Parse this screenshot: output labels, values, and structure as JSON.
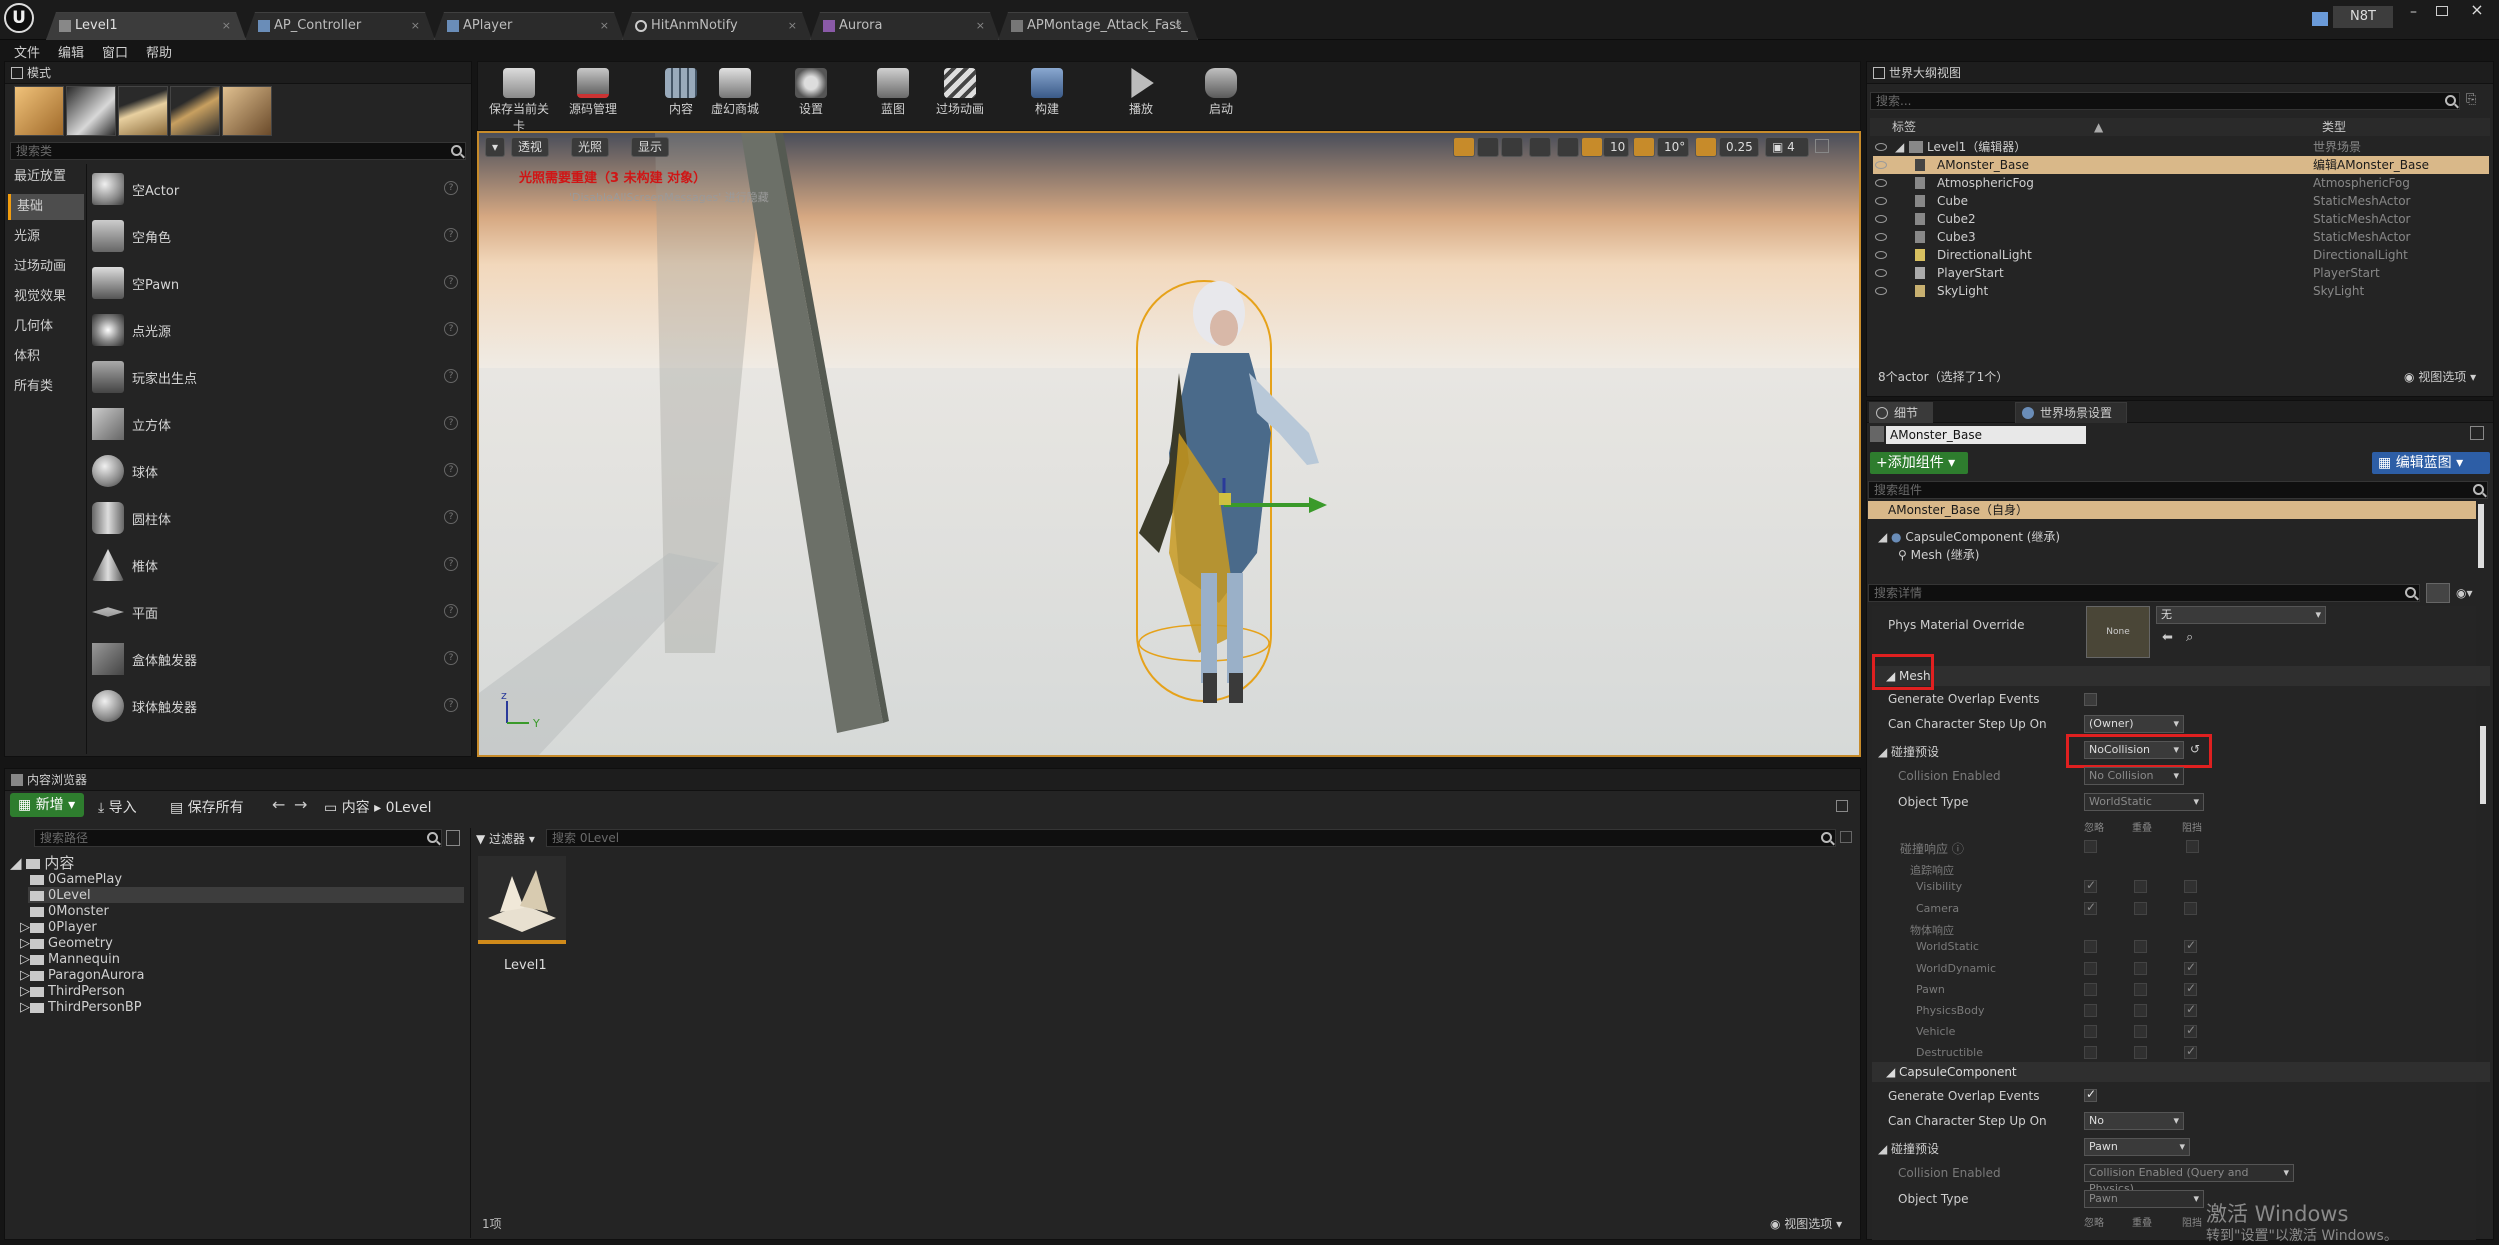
{
  "window": {
    "tabs": [
      {
        "label": "Level1"
      },
      {
        "label": "AP_Controller"
      },
      {
        "label": "APlayer"
      },
      {
        "label": "HitAnmNotify"
      },
      {
        "label": "Aurora"
      },
      {
        "label": "APMontage_Attack_Fast_"
      }
    ],
    "user": "N8T",
    "close": "×"
  },
  "menu": [
    "文件",
    "编辑",
    "窗口",
    "帮助"
  ],
  "modes": {
    "title": "模式",
    "search_placeholder": "搜索类",
    "categories": [
      "最近放置",
      "基础",
      "光源",
      "过场动画",
      "视觉效果",
      "几何体",
      "体积",
      "所有类"
    ],
    "items": [
      "空Actor",
      "空角色",
      "空Pawn",
      "点光源",
      "玩家出生点",
      "立方体",
      "球体",
      "圆柱体",
      "椎体",
      "平面",
      "盒体触发器",
      "球体触发器"
    ]
  },
  "toolbar": {
    "buttons": [
      "保存当前关卡",
      "源码管理",
      "内容",
      "虚幻商城",
      "设置",
      "蓝图",
      "过场动画",
      "构建",
      "播放",
      "启动"
    ]
  },
  "viewport": {
    "perspective": "透视",
    "lit": "光照",
    "show": "显示",
    "warning": "光照需要重建（3 未构建 对象）",
    "subwarning": "'DisableAllScreenMessages' 进行隐藏",
    "grid_snap": "10",
    "rot_snap": "10°",
    "scale_snap": "0.25",
    "cam_speed": "4"
  },
  "outliner": {
    "title": "世界大纲视图",
    "search_placeholder": "搜索...",
    "col_label": "标签",
    "col_type": "类型",
    "rows": [
      {
        "label": "Level1（编辑器）",
        "type": "世界场景"
      },
      {
        "label": "AMonster_Base",
        "type": "编辑AMonster_Base"
      },
      {
        "label": "AtmosphericFog",
        "type": "AtmosphericFog"
      },
      {
        "label": "Cube",
        "type": "StaticMeshActor"
      },
      {
        "label": "Cube2",
        "type": "StaticMeshActor"
      },
      {
        "label": "Cube3",
        "type": "StaticMeshActor"
      },
      {
        "label": "DirectionalLight",
        "type": "DirectionalLight"
      },
      {
        "label": "PlayerStart",
        "type": "PlayerStart"
      },
      {
        "label": "SkyLight",
        "type": "SkyLight"
      }
    ],
    "footer": "8个actor（选择了1个）",
    "view_options": "视图选项"
  },
  "details": {
    "tab1": "细节",
    "tab2": "世界场景设置",
    "name": "AMonster_Base",
    "add_component": "+添加组件",
    "edit_blueprint": "编辑蓝图",
    "search_components": "搜索组件",
    "tree": [
      "AMonster_Base（自身）",
      "CapsuleComponent (继承)",
      "Mesh (继承)"
    ],
    "search_details": "搜索详情",
    "phys_label": "Phys Material Override",
    "phys_value": "None",
    "phys_none": "无",
    "mesh": {
      "header": "Mesh",
      "gen_overlap": "Generate Overlap Events",
      "step_up": "Can Character Step Up On",
      "step_up_val": "(Owner)",
      "preset": "碰撞预设",
      "preset_val": "NoCollision",
      "enabled": "Collision Enabled",
      "enabled_val": "No Collision",
      "obj_type": "Object Type",
      "obj_type_val": "WorldStatic",
      "cols": [
        "忽略",
        "重叠",
        "阻挡"
      ],
      "response": "碰撞响应",
      "trace": "追踪响应",
      "visibility": "Visibility",
      "camera": "Camera",
      "object": "物体响应",
      "objects": [
        "WorldStatic",
        "WorldDynamic",
        "Pawn",
        "PhysicsBody",
        "Vehicle",
        "Destructible"
      ]
    },
    "capsule": {
      "header": "CapsuleComponent",
      "gen_overlap": "Generate Overlap Events",
      "step_up": "Can Character Step Up On",
      "step_up_val": "No",
      "preset": "碰撞预设",
      "preset_val": "Pawn",
      "enabled": "Collision Enabled",
      "enabled_val": "Collision Enabled (Query and Physics)",
      "obj_type": "Object Type",
      "obj_type_val": "Pawn",
      "cols": [
        "忽略",
        "重叠",
        "阻挡"
      ]
    }
  },
  "content_browser": {
    "title": "内容浏览器",
    "new": "新增",
    "import": "导入",
    "save_all": "保存所有",
    "path_root": "内容",
    "path_leaf": "0Level",
    "search_paths": "搜索路径",
    "filters": "过滤器",
    "search_assets": "搜索 0Level",
    "root": "内容",
    "folders": [
      "0GamePlay",
      "0Level",
      "0Monster",
      "0Player",
      "Geometry",
      "Mannequin",
      "ParagonAurora",
      "ThirdPerson",
      "ThirdPersonBP"
    ],
    "asset": "Level1",
    "count": "1项",
    "view_options": "视图选项"
  },
  "watermark": {
    "line1": "激活 Windows",
    "line2": "转到\"设置\"以激活 Windows。"
  }
}
